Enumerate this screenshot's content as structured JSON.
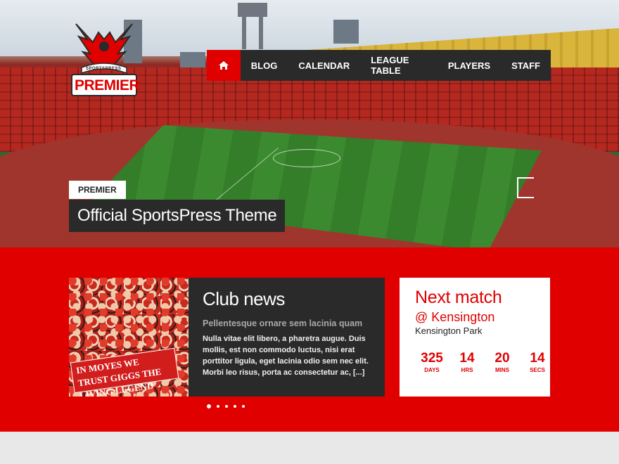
{
  "brand": {
    "name": "PREMIER",
    "tagline": "SPORTSPRESS"
  },
  "nav": {
    "home_icon": "home-icon",
    "items": [
      {
        "label": "BLOG"
      },
      {
        "label": "CALENDAR"
      },
      {
        "label": "LEAGUE TABLE"
      },
      {
        "label": "PLAYERS"
      },
      {
        "label": "STAFF"
      }
    ]
  },
  "hero": {
    "tag": "PREMIER",
    "title": "Official SportsPress Theme"
  },
  "news": {
    "title": "Club news",
    "subtitle": "Pellentesque ornare sem lacinia quam",
    "body": "Nulla vitae elit libero, a pharetra augue. Duis mollis, est non commodo luctus, nisi erat porttitor ligula, eget lacinia odio sem nec elit. Morbi leo risus, porta ac consectetur ac, [...]",
    "banner_text": "IN MOYES WE TRUST GIGGS THE LIVING LEGEND"
  },
  "slider": {
    "dot_count": 5,
    "active_index": 0
  },
  "next_match": {
    "title": "Next match",
    "team": "@ Kensington",
    "venue": "Kensington Park",
    "countdown": [
      {
        "value": "325",
        "label": "DAYS"
      },
      {
        "value": "14",
        "label": "HRS"
      },
      {
        "value": "20",
        "label": "MINS"
      },
      {
        "value": "14",
        "label": "SECS"
      }
    ]
  },
  "colors": {
    "accent": "#e00000",
    "dark": "#2a2a2a",
    "footer": "#e8e8e8"
  }
}
